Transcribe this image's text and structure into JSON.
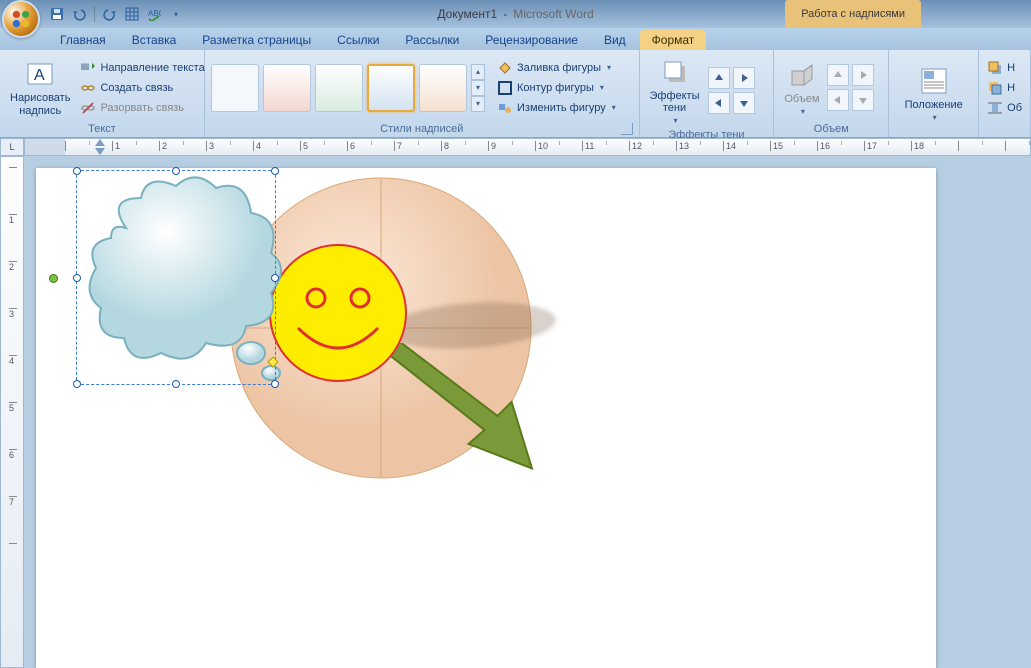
{
  "title": {
    "doc": "Документ1",
    "app": "Microsoft Word",
    "contextual": "Работа с надписями"
  },
  "qat_icons": [
    "save-icon",
    "undo-icon",
    "redo-icon",
    "table-icon",
    "spellcheck-icon"
  ],
  "tabs": [
    {
      "label": "Главная"
    },
    {
      "label": "Вставка"
    },
    {
      "label": "Разметка страницы"
    },
    {
      "label": "Ссылки"
    },
    {
      "label": "Рассылки"
    },
    {
      "label": "Рецензирование"
    },
    {
      "label": "Вид"
    },
    {
      "label": "Формат",
      "active": true
    }
  ],
  "ribbon": {
    "text": {
      "label": "Текст",
      "draw": "Нарисовать\nнадпись",
      "direction": "Направление текста",
      "link": "Создать связь",
      "unlink": "Разорвать связь"
    },
    "styles": {
      "label": "Стили надписей",
      "fill": "Заливка фигуры",
      "outline": "Контур фигуры",
      "change": "Изменить фигуру"
    },
    "shadow": {
      "label": "Эффекты тени",
      "btn": "Эффекты\nтени"
    },
    "volume": {
      "label": "Объем",
      "btn": "Объем"
    },
    "position": {
      "label": "",
      "btn": "Положение"
    },
    "obj": {
      "label": "Об"
    }
  },
  "ruler": {
    "h_marks": [
      1,
      2,
      3,
      4,
      5,
      6,
      7,
      8,
      9,
      10,
      11,
      12,
      13,
      14,
      15,
      16,
      17,
      18
    ],
    "v_marks": [
      1,
      2,
      3,
      4,
      5,
      6,
      7
    ]
  },
  "corner": "L"
}
